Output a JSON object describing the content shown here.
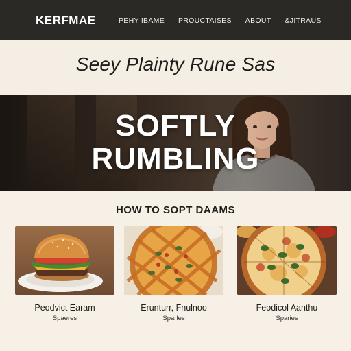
{
  "nav": {
    "logo": "KERFMAE",
    "links": [
      "PEHY IBAME",
      "PROUCTAISES",
      "ABOUT",
      "&JITRAUS"
    ]
  },
  "header": {
    "tagline": "Seey Plainty Rune Sas"
  },
  "hero": {
    "title_line1": "SOFTLY",
    "title_line2": "RUMBLING"
  },
  "section": {
    "title": "HOW TO SOPT DAAMS"
  },
  "cards": [
    {
      "title": "Peodvict Earam",
      "subtitle": "Spaeres",
      "image": "burger"
    },
    {
      "title": "Erunturr, Fnulnoo",
      "subtitle": "Sparles",
      "image": "pizza-lattice"
    },
    {
      "title": "Feodicol Aanthu",
      "subtitle": "Sparies",
      "image": "pizza-basil"
    }
  ],
  "colors": {
    "nav_bg": "#2b2926",
    "page_bg": "#f6f0e6",
    "text": "#1f1d1b"
  }
}
